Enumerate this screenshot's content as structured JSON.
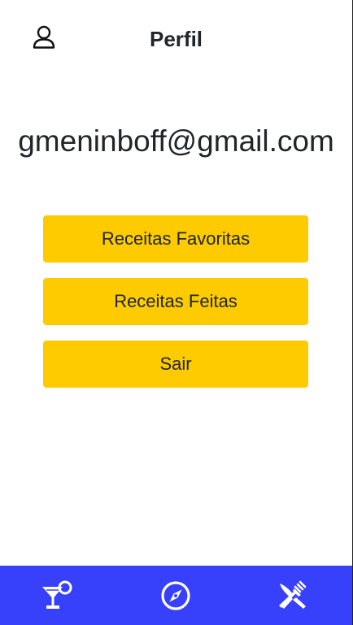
{
  "header": {
    "title": "Perfil",
    "profile_icon": "user-profile-icon"
  },
  "profile": {
    "email": "gmeninboff@gmail.com"
  },
  "buttons": {
    "favorite_recipes": "Receitas Favoritas",
    "done_recipes": "Receitas Feitas",
    "logout": "Sair"
  },
  "footer": {
    "icons": [
      "cocktail-icon",
      "compass-icon",
      "fork-knife-icon"
    ]
  },
  "colors": {
    "button": "#fdcb00",
    "footer": "#3741fc",
    "text": "#212529"
  }
}
